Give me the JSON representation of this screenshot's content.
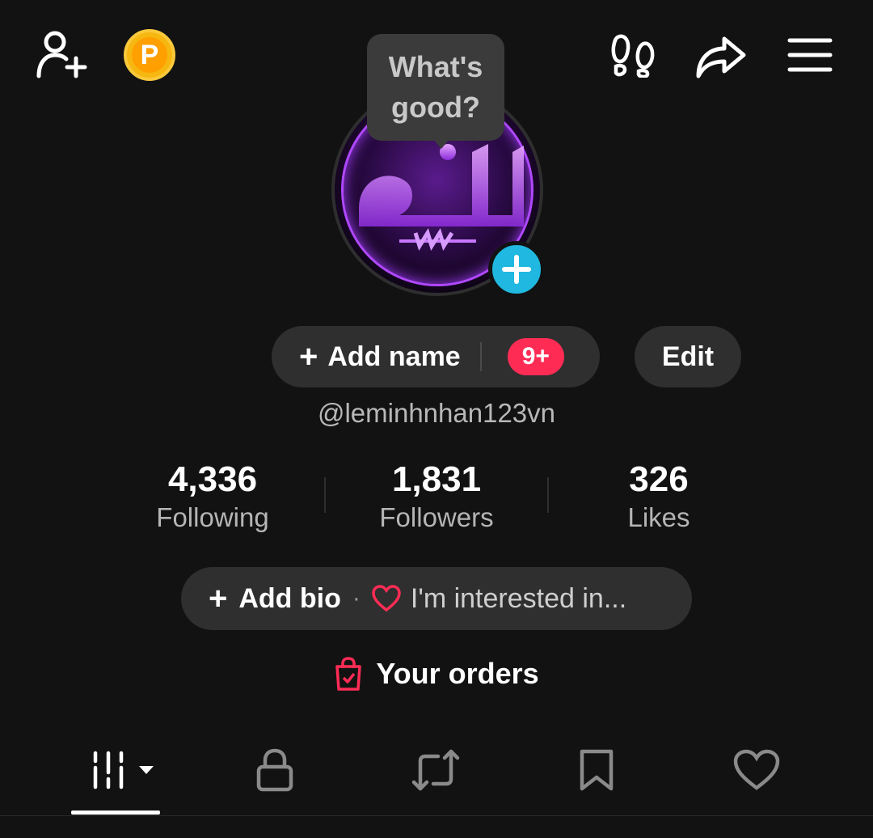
{
  "tooltip": {
    "line1": "What's",
    "line2": "good?"
  },
  "coin": {
    "letter": "P"
  },
  "profile": {
    "add_name_label": "Add name",
    "notification_badge": "9+",
    "edit_label": "Edit",
    "handle": "@leminhnhan123vn"
  },
  "stats": [
    {
      "value": "4,336",
      "label": "Following"
    },
    {
      "value": "1,831",
      "label": "Followers"
    },
    {
      "value": "326",
      "label": "Likes"
    }
  ],
  "bio": {
    "add_bio_label": "Add bio",
    "separator": "·",
    "interest_text": "I'm interested in..."
  },
  "orders": {
    "label": "Your orders"
  },
  "icons": {
    "top": [
      "add-friend-icon",
      "coin-icon",
      "footprints-icon",
      "share-icon",
      "menu-icon"
    ],
    "tabs": [
      "videos-grid-icon",
      "lock-icon",
      "repost-icon",
      "bookmark-icon",
      "heart-icon"
    ]
  },
  "colors": {
    "background": "#121212",
    "pill": "#2f2f2f",
    "accent_red": "#fe2c55",
    "accent_cyan": "#20b8e0",
    "coin": "#f6b711"
  }
}
